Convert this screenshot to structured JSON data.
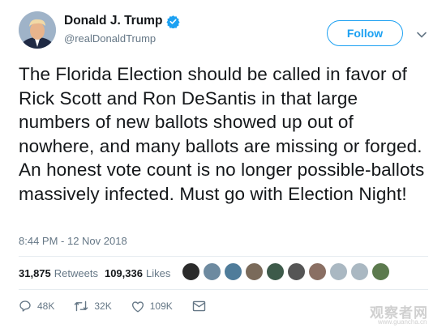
{
  "author": {
    "display_name": "Donald J. Trump",
    "handle": "@realDonaldTrump",
    "verified": true
  },
  "follow_label": "Follow",
  "tweet_text": "The Florida Election should be called in favor of Rick Scott and Ron DeSantis in that large numbers of new ballots showed up out of nowhere, and many ballots are missing or forged. An honest vote count is no longer possible-ballots massively infected. Must go with Election Night!",
  "timestamp": "8:44 PM - 12 Nov 2018",
  "stats": {
    "retweets_count": "31,875",
    "retweets_label": "Retweets",
    "likes_count": "109,336",
    "likes_label": "Likes"
  },
  "actions": {
    "reply_count": "48K",
    "retweet_count": "32K",
    "like_count": "109K"
  },
  "watermark": {
    "text": "观察者网",
    "subtext": "www.guancha.cn"
  },
  "colors": {
    "accent": "#1da1f2",
    "text": "#14171a",
    "secondary": "#657786"
  },
  "icons": [
    "verified-badge-icon",
    "chevron-down-icon",
    "reply-icon",
    "retweet-icon",
    "like-icon",
    "direct-message-icon"
  ]
}
